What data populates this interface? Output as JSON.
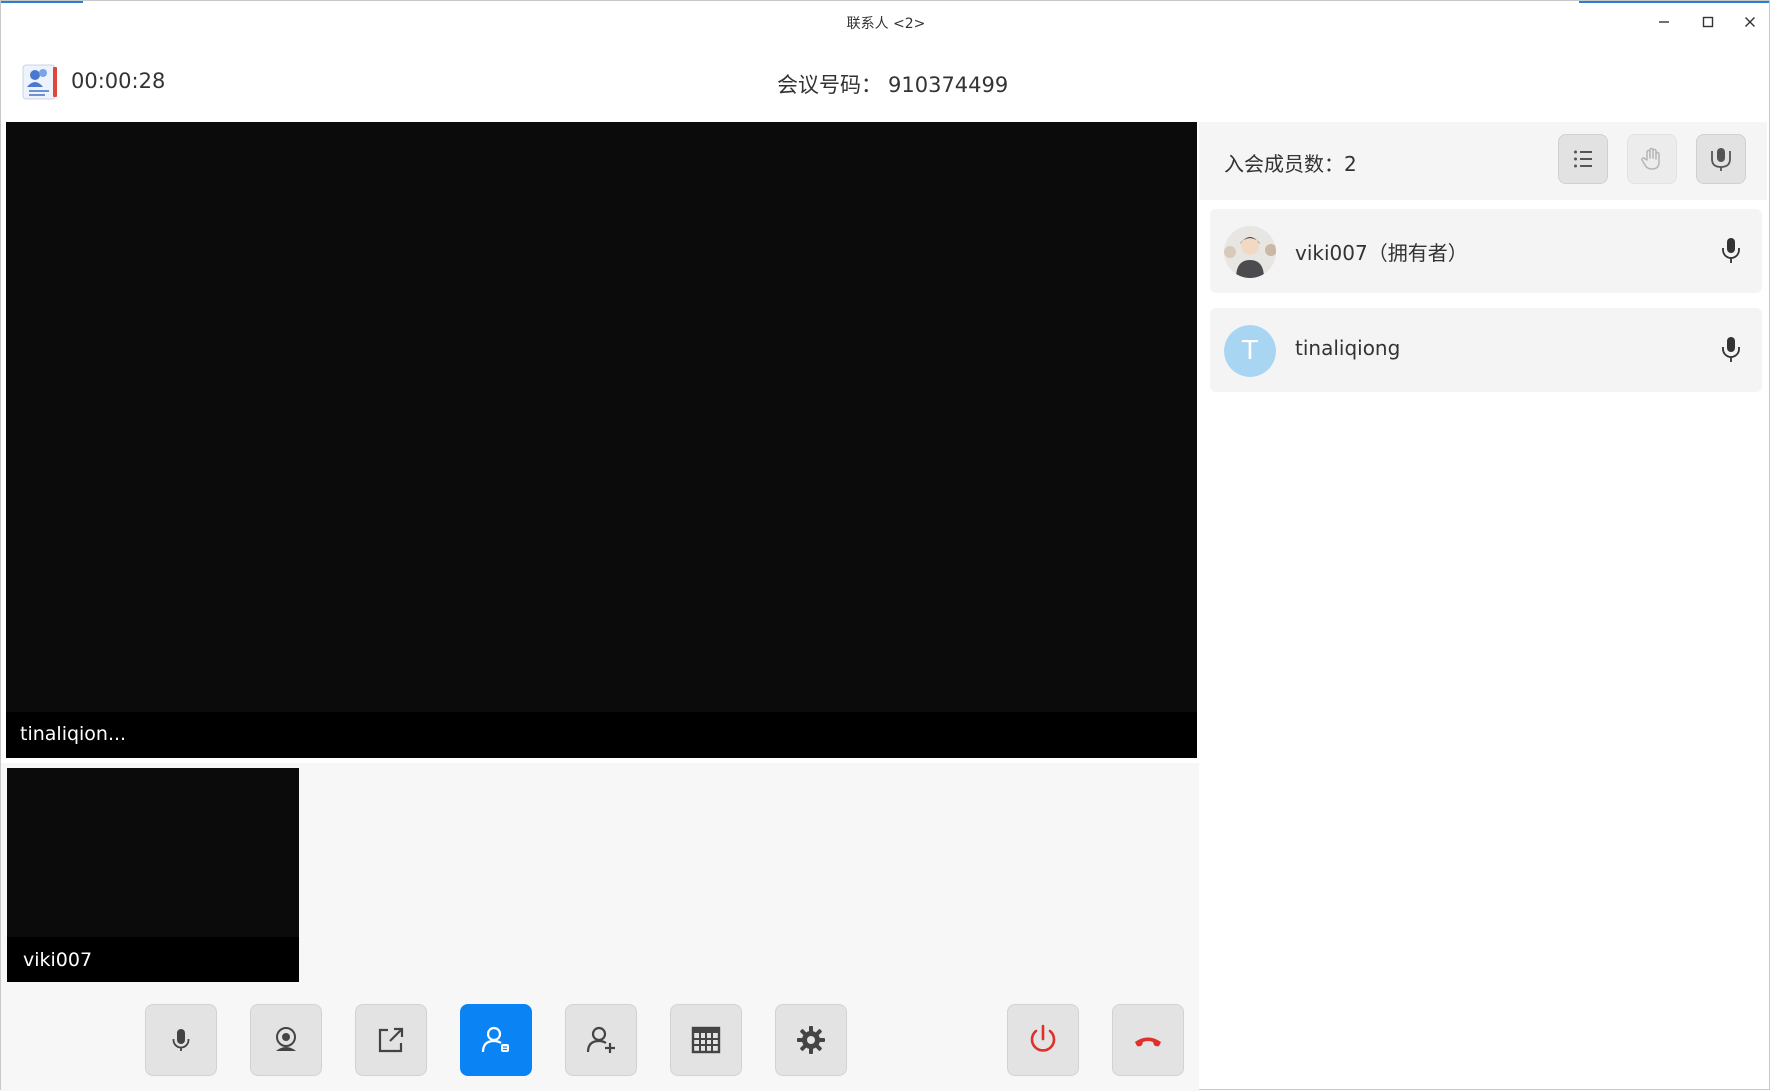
{
  "window": {
    "title": "联系人 <2>",
    "controls": [
      "minimize-icon",
      "maximize-icon",
      "close-icon"
    ]
  },
  "header": {
    "timer": "00:00:28",
    "meeting_id_label": "会议号码：",
    "meeting_id": "910374499"
  },
  "main_video": {
    "participant_label": "tinaliqion..."
  },
  "thumbnails": [
    {
      "participant_label": "viki007"
    }
  ],
  "toolbar": {
    "buttons": [
      {
        "icon": "microphone-icon"
      },
      {
        "icon": "camera-icon"
      },
      {
        "icon": "share-screen-icon"
      },
      {
        "icon": "member-list-icon",
        "active": true
      },
      {
        "icon": "invite-member-icon"
      },
      {
        "icon": "grid-layout-icon"
      },
      {
        "icon": "gear-icon"
      },
      {
        "icon": "power-icon",
        "color": "#e0302a"
      },
      {
        "icon": "hang-up-icon",
        "color": "#e0302a"
      }
    ]
  },
  "panel": {
    "member_count_label": "入会成员数：2",
    "header_buttons": [
      "list-icon",
      "raise-hand-icon",
      "mute-all-icon"
    ],
    "members": [
      {
        "name": "viki007（拥有者）",
        "avatar": "photo-avatar",
        "status_icon": "microphone-icon"
      },
      {
        "name": "tinaliqiong",
        "avatar_letter": "T",
        "avatar_color": "#a8d6f2",
        "status_icon": "microphone-icon"
      }
    ]
  },
  "colors": {
    "accent": "#0a84f5",
    "danger": "#e0302a",
    "video_bg": "#0b0b0b"
  }
}
